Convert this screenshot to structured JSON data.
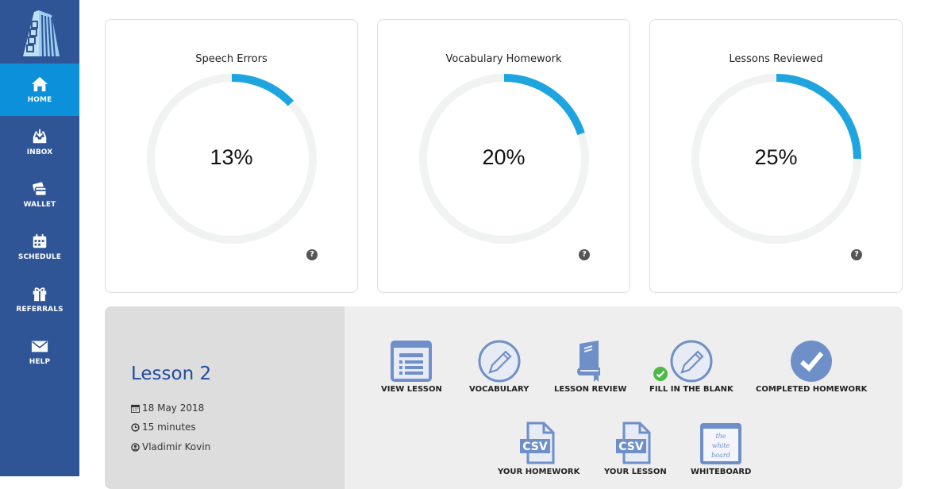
{
  "sidebar": {
    "logo": "building-logo",
    "items": [
      {
        "label": "HOME",
        "icon": "home-icon",
        "active": true
      },
      {
        "label": "INBOX",
        "icon": "inbox-icon",
        "active": false
      },
      {
        "label": "WALLET",
        "icon": "wallet-icon",
        "active": false
      },
      {
        "label": "SCHEDULE",
        "icon": "calendar-icon",
        "active": false
      },
      {
        "label": "REFERRALS",
        "icon": "gift-icon",
        "active": false
      },
      {
        "label": "HELP",
        "icon": "envelope-icon",
        "active": false
      }
    ]
  },
  "stats": [
    {
      "title": "Speech Errors",
      "value_text": "13%",
      "percent": 13
    },
    {
      "title": "Vocabulary Homework",
      "value_text": "20%",
      "percent": 20
    },
    {
      "title": "Lessons Reviewed",
      "value_text": "25%",
      "percent": 25
    }
  ],
  "colors": {
    "sidebar_bg": "#2f5597",
    "active_bg": "#0b90d9",
    "ring_fill": "#1ea5e0",
    "ring_track": "#f1f2f2",
    "icon_blue": "#6f8fc9",
    "lesson_title": "#1f4aa0",
    "done_green": "#4cb947"
  },
  "lesson": {
    "title": "Lesson 2",
    "date": "18 May 2018",
    "duration": "15 minutes",
    "teacher": "Vladimir Kovin"
  },
  "actions": [
    {
      "label": "VIEW LESSON",
      "icon": "view-lesson-icon"
    },
    {
      "label": "VOCABULARY",
      "icon": "pencil-circle-icon"
    },
    {
      "label": "LESSON REVIEW",
      "icon": "book-icon"
    },
    {
      "label": "FILL IN THE BLANK",
      "icon": "pencil-circle-icon",
      "completed": true
    },
    {
      "label": "COMPLETED HOMEWORK",
      "icon": "checkmark-circle-icon"
    },
    {
      "label": "YOUR HOMEWORK",
      "icon": "csv-file-icon"
    },
    {
      "label": "YOUR LESSON",
      "icon": "csv-file-icon"
    },
    {
      "label": "WHITEBOARD",
      "icon": "whiteboard-icon",
      "whiteboard_text": [
        "the",
        "white",
        "board"
      ]
    }
  ],
  "help_symbol": "?"
}
